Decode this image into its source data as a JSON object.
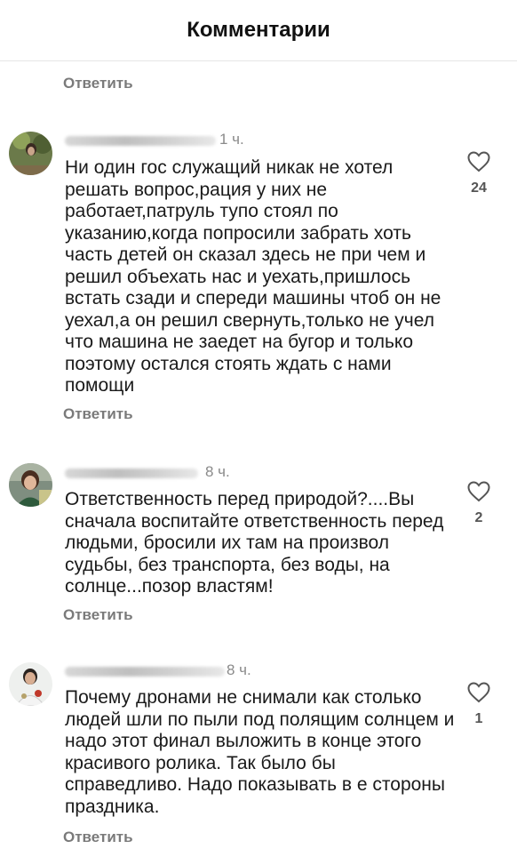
{
  "header": {
    "title": "Комментарии"
  },
  "top_reply": "Ответить",
  "comments": [
    {
      "time": "1 ч.",
      "text": "Ни один гос служащий никак не хотел решать вопрос,рация у них не работает,патруль тупо стоял по указанию,когда попросили забрать хоть часть детей он сказал здесь не при чем и решил объехать нас и уехать,пришлось встать сзади  и спереди машины чтоб он не уехал,а он решил свернуть,только не учел что машина не заедет на бугор и только поэтому остался стоять ждать с нами помощи",
      "likes": "24",
      "reply": "Ответить"
    },
    {
      "time": "8 ч.",
      "text": "Ответственность перед природой?....Вы сначала воспитайте ответственность перед людьми, бросили их там на произвол судьбы, без транспорта, без воды, на солнце...позор властям!",
      "likes": "2",
      "reply": "Ответить"
    },
    {
      "time": "8 ч.",
      "text": "Почему дронами не снимали как столько людей шли по пыли под полящим солнцем и надо этот финал выложить в конце этого красивого ролика. Так было бы справедливо. Надо показывать в е стороны праздника.",
      "likes": "1",
      "reply": "Ответить"
    }
  ],
  "icons": {
    "like": "heart-outline-icon"
  },
  "colors": {
    "text": "#1a1a1a",
    "muted": "#7a7a7a",
    "divider": "#e6e6e6"
  }
}
